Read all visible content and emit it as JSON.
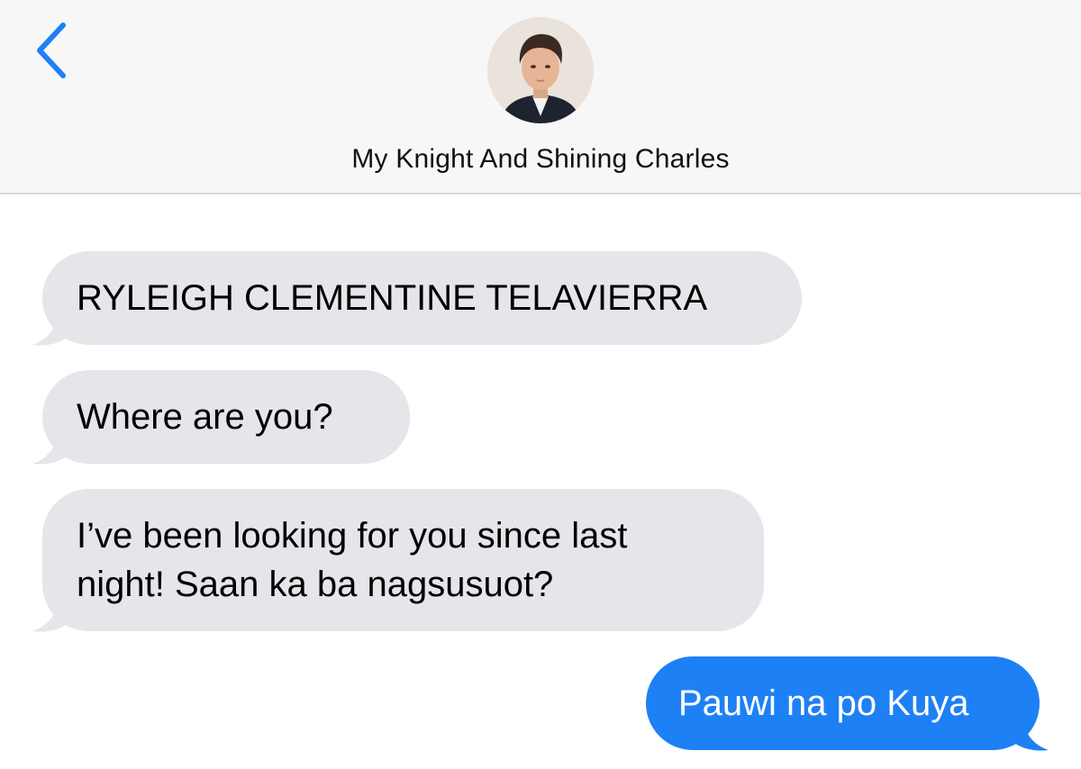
{
  "header": {
    "contact_name": "My Knight And Shining Charles",
    "back_icon": "chevron-left-icon",
    "accent_color": "#1e80f5"
  },
  "messages": [
    {
      "direction": "incoming",
      "text": "RYLEIGH CLEMENTINE TELAVIERRA"
    },
    {
      "direction": "incoming",
      "text": "Where are you?"
    },
    {
      "direction": "incoming",
      "lines": [
        "I’ve been looking for you since last",
        "night! Saan ka ba nagsusuot?"
      ]
    },
    {
      "direction": "outgoing",
      "text": "Pauwi na po Kuya"
    }
  ],
  "colors": {
    "incoming_bubble": "#e5e5ea",
    "outgoing_bubble": "#1e80f5",
    "header_bg": "#f7f7f7"
  }
}
